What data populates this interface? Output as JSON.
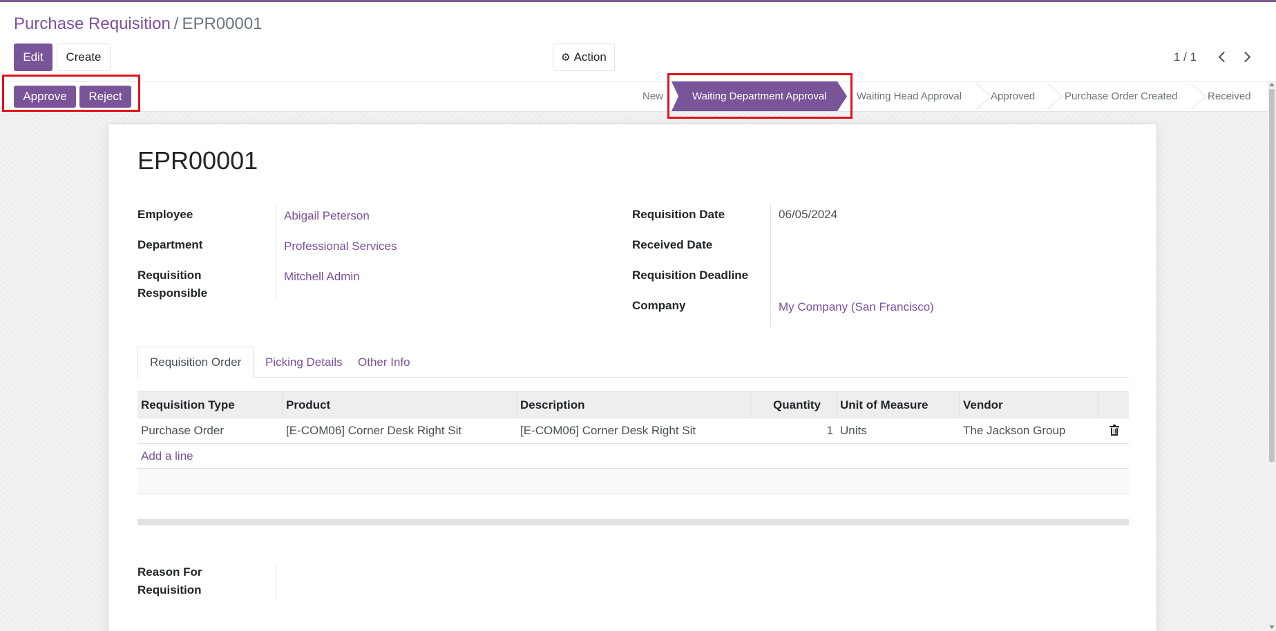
{
  "breadcrumb": {
    "parent": "Purchase Requisition",
    "separator": "/",
    "current": "EPR00001"
  },
  "toolbar": {
    "edit_label": "Edit",
    "create_label": "Create",
    "action_label": "Action",
    "action_icon": "gear-icon"
  },
  "pager": {
    "text": "1 / 1"
  },
  "statusbar": {
    "approve_label": "Approve",
    "reject_label": "Reject",
    "stages": [
      "New",
      "Waiting Department Approval",
      "Waiting Head Approval",
      "Approved",
      "Purchase Order Created",
      "Received"
    ],
    "active_stage": "Waiting Department Approval"
  },
  "record": {
    "title": "EPR00001",
    "labels": {
      "employee": "Employee",
      "department": "Department",
      "responsible_line1": "Requisition",
      "responsible_line2": "Responsible",
      "requisition_date": "Requisition Date",
      "received_date": "Received Date",
      "deadline": "Requisition Deadline",
      "company": "Company",
      "reason_line1": "Reason For",
      "reason_line2": "Requisition"
    },
    "values": {
      "employee": "Abigail Peterson",
      "department": "Professional Services",
      "responsible": "Mitchell Admin",
      "requisition_date": "06/05/2024",
      "received_date": "",
      "deadline": "",
      "company": "My Company (San Francisco)",
      "reason": ""
    }
  },
  "tabs": [
    "Requisition Order",
    "Picking Details",
    "Other Info"
  ],
  "table": {
    "headers": [
      "Requisition Type",
      "Product",
      "Description",
      "Quantity",
      "Unit of Measure",
      "Vendor"
    ],
    "rows": [
      [
        "Purchase Order",
        "[E-COM06] Corner Desk Right Sit",
        "[E-COM06] Corner Desk Right Sit",
        "1",
        "Units",
        "The Jackson Group"
      ]
    ],
    "add_line_label": "Add a line"
  },
  "colors": {
    "brand": "#7a5499",
    "link": "#7c4f9e",
    "highlight": "#e0111b"
  }
}
